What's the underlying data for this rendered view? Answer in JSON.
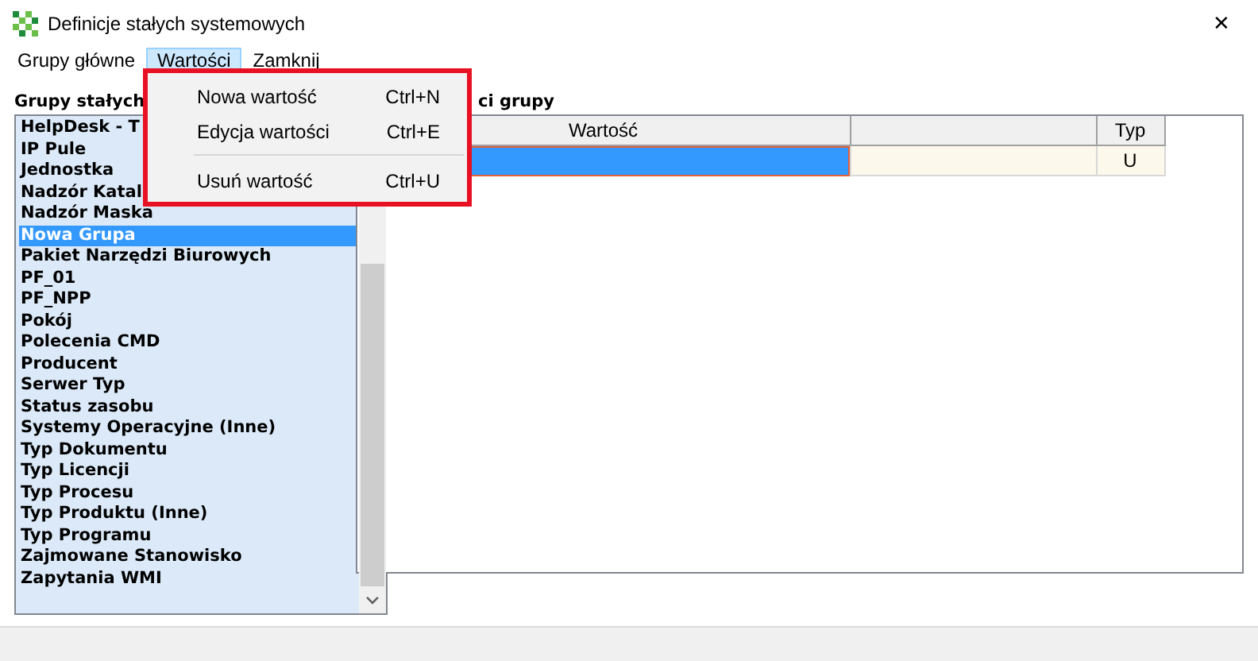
{
  "window": {
    "title": "Definicje stałych systemowych",
    "close": "✕"
  },
  "menubar": [
    {
      "label": "Grupy główne",
      "selected": false
    },
    {
      "label": "Wartości",
      "selected": true
    },
    {
      "label": "Zamknij",
      "selected": false
    }
  ],
  "dropdown": [
    {
      "kind": "item",
      "label": "Nowa wartość",
      "shortcut": "Ctrl+N"
    },
    {
      "kind": "item",
      "label": "Edycja wartości",
      "shortcut": "Ctrl+E"
    },
    {
      "kind": "separator"
    },
    {
      "kind": "item",
      "label": "Usuń wartość",
      "shortcut": "Ctrl+U"
    }
  ],
  "groups": {
    "label": "Grupy stałych",
    "items": [
      {
        "label": "HelpDesk - T",
        "selected": false
      },
      {
        "label": "IP Pule",
        "selected": false
      },
      {
        "label": "Jednostka",
        "selected": false
      },
      {
        "label": "Nadzór Katal",
        "selected": false
      },
      {
        "label": "Nadzór Maska",
        "selected": false
      },
      {
        "label": "Nowa Grupa",
        "selected": true
      },
      {
        "label": "Pakiet Narzędzi Biurowych",
        "selected": false
      },
      {
        "label": "PF_01",
        "selected": false
      },
      {
        "label": "PF_NPP",
        "selected": false
      },
      {
        "label": "Pokój",
        "selected": false
      },
      {
        "label": "Polecenia CMD",
        "selected": false
      },
      {
        "label": "Producent",
        "selected": false
      },
      {
        "label": "Serwer Typ",
        "selected": false
      },
      {
        "label": "Status zasobu",
        "selected": false
      },
      {
        "label": "Systemy Operacyjne (Inne)",
        "selected": false
      },
      {
        "label": "Typ Dokumentu",
        "selected": false
      },
      {
        "label": "Typ Licencji",
        "selected": false
      },
      {
        "label": "Typ Procesu",
        "selected": false
      },
      {
        "label": "Typ Produktu (Inne)",
        "selected": false
      },
      {
        "label": "Typ Programu",
        "selected": false
      },
      {
        "label": "Zajmowane Stanowisko",
        "selected": false
      },
      {
        "label": "Zapytania WMI",
        "selected": false
      }
    ]
  },
  "values": {
    "label": "ci grupy",
    "columns": [
      "Wartość",
      "",
      "Typ"
    ],
    "rows": [
      {
        "selected": true,
        "cells": [
          "",
          "",
          "U"
        ]
      }
    ]
  }
}
